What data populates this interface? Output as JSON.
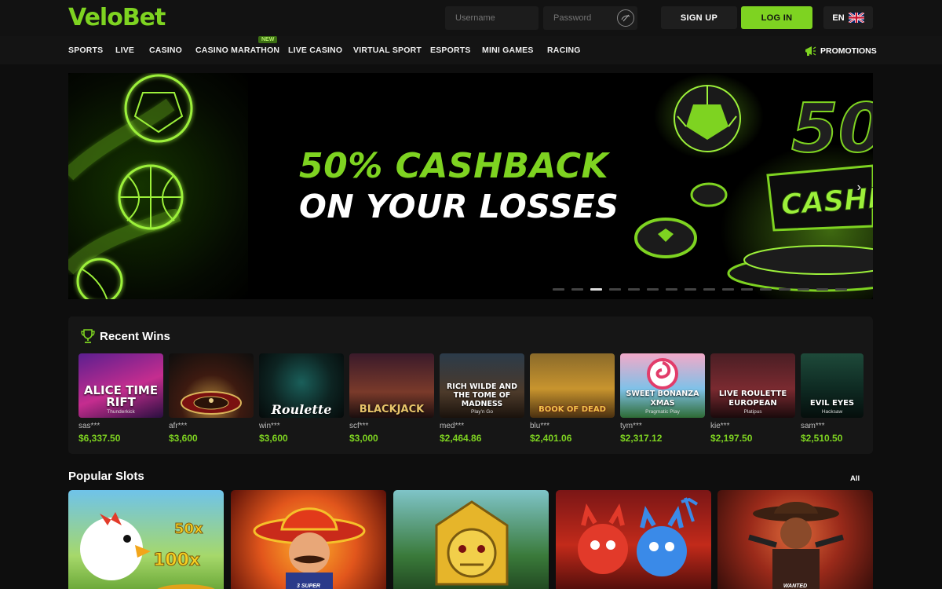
{
  "header": {
    "logo": "VeloBet",
    "username_placeholder": "Username",
    "password_placeholder": "Password",
    "signup_label": "SIGN UP",
    "login_label": "LOG IN",
    "language": "EN",
    "accent_color": "#7ed321"
  },
  "nav": {
    "items": [
      "SPORTS",
      "LIVE",
      "CASINO",
      "CASINO MARATHON",
      "LIVE CASINO",
      "VIRTUAL SPORT",
      "ESPORTS",
      "MINI GAMES",
      "RACING"
    ],
    "new_badge": "NEW",
    "promotions": "PROMOTIONS"
  },
  "banner": {
    "line1": "50% CASHBACK",
    "line2": "ON YOUR LOSSES",
    "art_text_big": "50",
    "art_text_sub": "CASHBA",
    "slide_count": 16,
    "active_slide": 3
  },
  "recent_wins": {
    "title": "Recent Wins",
    "items": [
      {
        "game": "ALICE TIME RIFT",
        "provider": "Thunderkick",
        "user": "sas***",
        "amount": "$6,337.50"
      },
      {
        "game": "",
        "provider": "",
        "user": "afr***",
        "amount": "$3,600"
      },
      {
        "game": "Roulette",
        "provider": "",
        "user": "win***",
        "amount": "$3,600"
      },
      {
        "game": "BLACKJACK",
        "provider": "",
        "user": "scf***",
        "amount": "$3,000"
      },
      {
        "game": "RICH WILDE AND THE TOME OF MADNESS",
        "provider": "Play'n Go",
        "user": "med***",
        "amount": "$2,464.86"
      },
      {
        "game": "BOOK OF DEAD",
        "provider": "",
        "user": "blu***",
        "amount": "$2,401.06"
      },
      {
        "game": "SWEET BONANZA XMAS",
        "provider": "Pragmatic Play",
        "user": "tym***",
        "amount": "$2,317.12"
      },
      {
        "game": "LIVE ROULETTE EUROPEAN",
        "provider": "Platipus",
        "user": "kie***",
        "amount": "$2,197.50"
      },
      {
        "game": "EVIL EYES",
        "provider": "Hacksaw",
        "user": "sam***",
        "amount": "$2,510.50"
      }
    ]
  },
  "popular_slots": {
    "title": "Popular Slots",
    "all_label": "All",
    "items": [
      {
        "label": ""
      },
      {
        "label": "3 SUPER"
      },
      {
        "label": ""
      },
      {
        "label": ""
      },
      {
        "label": "WANTED"
      }
    ]
  }
}
